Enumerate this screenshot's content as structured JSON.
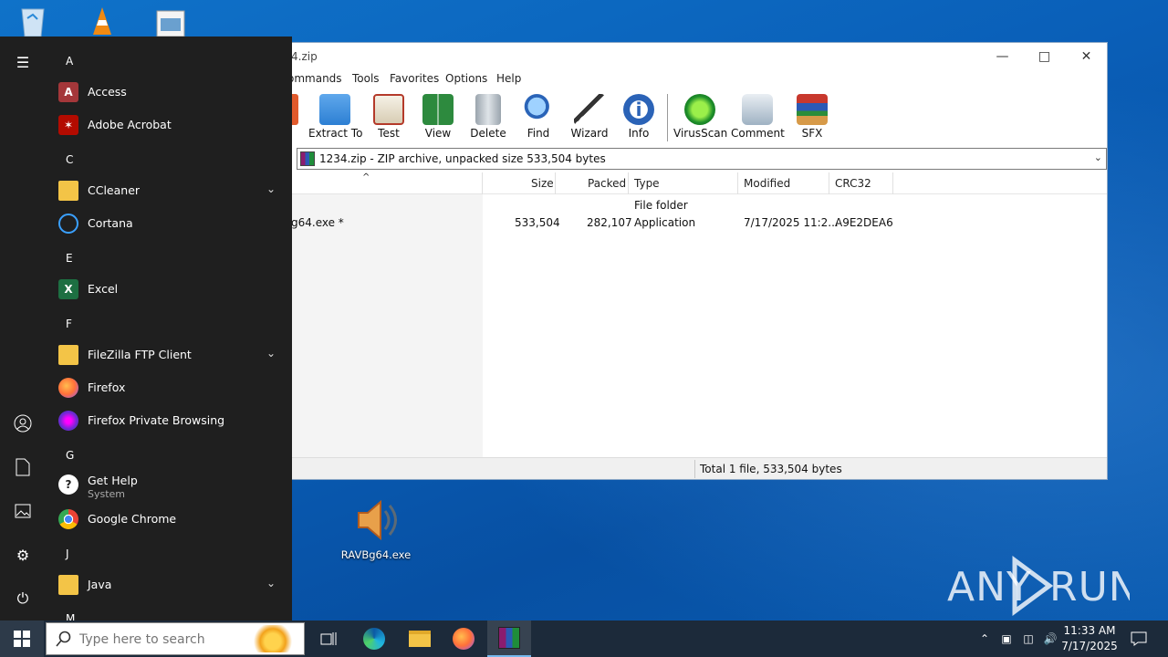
{
  "desktop": {
    "icons_top": [
      "recycle-bin-icon",
      "vlc-icon",
      "image-file-icon"
    ],
    "file_icon_label": "RAVBg64.exe",
    "watermark": "ANY RUN"
  },
  "winrar": {
    "title": "4.zip",
    "menu": [
      "ommands",
      "Tools",
      "Favorites",
      "Options",
      "Help"
    ],
    "toolbar": [
      "Extract To",
      "Test",
      "View",
      "Delete",
      "Find",
      "Wizard",
      "Info",
      "VirusScan",
      "Comment",
      "SFX"
    ],
    "path": "1234.zip - ZIP archive, unpacked size 533,504 bytes",
    "columns": [
      "Size",
      "Packed",
      "Type",
      "Modified",
      "CRC32"
    ],
    "sort_arrow": "^",
    "rows": [
      {
        "name": "",
        "size": "",
        "packed": "",
        "type": "File folder",
        "modified": "",
        "crc": ""
      },
      {
        "name": "g64.exe *",
        "size": "533,504",
        "packed": "282,107",
        "type": "Application",
        "modified": "7/17/2025 11:2...",
        "crc": "A9E2DEA6"
      }
    ],
    "status": "Total 1 file, 533,504 bytes"
  },
  "startmenu": {
    "sections": [
      {
        "letter": "A",
        "apps": [
          {
            "name": "Access"
          },
          {
            "name": "Adobe Acrobat"
          }
        ]
      },
      {
        "letter": "C",
        "apps": [
          {
            "name": "CCleaner",
            "expandable": true
          },
          {
            "name": "Cortana"
          }
        ]
      },
      {
        "letter": "E",
        "apps": [
          {
            "name": "Excel"
          }
        ]
      },
      {
        "letter": "F",
        "apps": [
          {
            "name": "FileZilla FTP Client",
            "expandable": true
          },
          {
            "name": "Firefox"
          },
          {
            "name": "Firefox Private Browsing"
          }
        ]
      },
      {
        "letter": "G",
        "apps": [
          {
            "name": "Get Help",
            "sub": "System"
          },
          {
            "name": "Google Chrome"
          }
        ]
      },
      {
        "letter": "J",
        "apps": [
          {
            "name": "Java",
            "expandable": true
          }
        ]
      },
      {
        "letter": "M",
        "apps": []
      }
    ]
  },
  "taskbar": {
    "search_placeholder": "Type here to search",
    "time": "11:33 AM",
    "date": "7/17/2025"
  }
}
